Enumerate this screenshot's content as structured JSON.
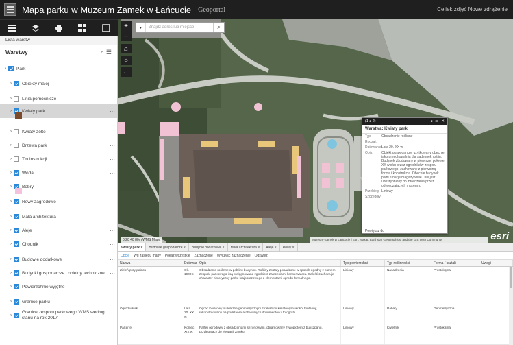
{
  "header": {
    "title": "Mapa parku w Muzeum  Zamek w Łańcucie",
    "subtitle": "Geoportal",
    "right_links": "Celiek zdjęć  Nowe zdrążenie"
  },
  "toolbar": {
    "icons": [
      "list-icon",
      "layers-icon",
      "printer-icon",
      "grid-icon",
      "menu-icon"
    ]
  },
  "sidebar": {
    "tab_label": "Lista warstw",
    "panel_title": "Warstwy",
    "layers": [
      {
        "label": "Park",
        "checked": true,
        "level": 0
      },
      {
        "label": "Obiekty małej",
        "checked": true,
        "level": 1
      },
      {
        "label": "Linia pomocnicze",
        "checked": false,
        "level": 1
      },
      {
        "label": "Kwiaty park",
        "checked": true,
        "level": 1,
        "selected": true,
        "swatch": "#7a4a2a"
      },
      {
        "label": "Kwiaty żółte",
        "checked": false,
        "level": 1
      },
      {
        "label": "Drzewa park",
        "checked": false,
        "level": 1
      },
      {
        "label": "Tło Instrukcji",
        "checked": false,
        "level": 1
      },
      {
        "label": "Woda",
        "checked": true,
        "level": 1
      },
      {
        "label": "Bobry",
        "checked": true,
        "level": 1,
        "swatch": "#f4c2dc"
      },
      {
        "label": "Rowy zagrodowe",
        "checked": true,
        "level": 1
      },
      {
        "label": "Mała architektura",
        "checked": true,
        "level": 1
      },
      {
        "label": "Aleje",
        "checked": true,
        "level": 1
      },
      {
        "label": "Chodnik",
        "checked": true,
        "level": 1
      },
      {
        "label": "Budowle dodatkowe",
        "checked": true,
        "level": 1
      },
      {
        "label": "Budynki gospodarcze i obiekty techniczne",
        "checked": true,
        "level": 1
      },
      {
        "label": "Powierzchnie wyjętne",
        "checked": true,
        "level": 1
      },
      {
        "label": "Granice parku",
        "checked": true,
        "level": 1
      },
      {
        "label": "Granice zespołu parkowego WMS według stanu na rok 2017",
        "checked": true,
        "level": 1
      }
    ]
  },
  "map": {
    "search_placeholder": "Znajdź adres lub miejsce",
    "scale_text": "0 20 40 80m  WMS Mapa",
    "attribution": "Muzeum-Zamek w Łańcucie | Esri, Maxar, Earthstar Geographics, and the GIS User Community",
    "esri_logo": "esri",
    "controls": [
      "plus-icon",
      "minus-icon",
      "home-icon",
      "locate-icon",
      "back-icon"
    ]
  },
  "popup": {
    "header": "(1 z 2)",
    "title": "Warstwa: Kwiaty park",
    "rows": [
      {
        "k": "Typ:",
        "v": "Obsadzenie roślinne"
      },
      {
        "k": "Rodzaj:",
        "v": ""
      },
      {
        "k": "Datowanie:",
        "v": "Lata 20. XX w."
      },
      {
        "k": "Opis:",
        "v": "Obiekt gospodarczy, użytkowany obecnie jako przechowalnia dla sadzonek roślin. Budynek zbudowany w pierwszej połowie XX wieku przez ogrodników zespołu parkowego, zachowany z pierwotną formą i konstrukcją. Obecnie budynek pełni funkcje magazynowe i nie jest udostępniony do zwiedzania przez odwiedzających muzeum."
      },
      {
        "k": "Przebieg:",
        "v": "Liniowy"
      },
      {
        "k": "Szczegóły:",
        "v": ""
      }
    ],
    "footer": "Powiększ do"
  },
  "bottom": {
    "tabs": [
      "Kwiaty park",
      "Budowle gospodarcze",
      "Budynki dodatkowe",
      "Mała architektura",
      "Aleje",
      "Rowy"
    ],
    "toolbar": [
      "Opcje",
      "Wg zasięgu mapy",
      "Pokaż wszystkie",
      "Zaznaczone",
      "Wyczyść zaznaczenie",
      "Odśwież"
    ],
    "columns": [
      "Nazwa",
      "Datowanie",
      "Opis",
      "Typ powierzchni",
      "Typ roślinności",
      "Forma / kształt",
      "Uwagi"
    ],
    "rows": [
      {
        "c1": "Zieleń przy pałacu",
        "c2": "Ok. 1900 r.",
        "c3": "Obsadzenie roślinne w pobliżu budynku. Rośliny zostały posadzone w sposób zgodny z planem zespołu parkowego i są pielęgnowane zgodnie z zaleceniami konserwatora. Całość zachowuje charakter historyczny parku krajobrazowego z elementami ogrodu formalnego.",
        "c4": "Liniowy",
        "c5": "Nasadzenia",
        "c6": "Prostokątna",
        "c7": ""
      },
      {
        "c1": "Ogród włoski",
        "c2": "Lata 20. XX w.",
        "c3": "Ogród kwiatowy o układzie geometrycznym z rabatami kwiatowymi wokół fontanny, rekonstruowany na podstawie archiwalnych dokumentów i fotografii.",
        "c4": "Liniowy",
        "c5": "Rabaty",
        "c6": "Geometryczna",
        "c7": ""
      },
      {
        "c1": "Parterre",
        "c2": "Koniec XIX w.",
        "c3": "Parter ogrodowy z obsadzeniami sezonowymi, obramowany żywopłotem z bukszpanu, przylegający do elewacji zamku.",
        "c4": "Liniowy",
        "c5": "Kwietnik",
        "c6": "Prostokątna",
        "c7": ""
      }
    ]
  }
}
